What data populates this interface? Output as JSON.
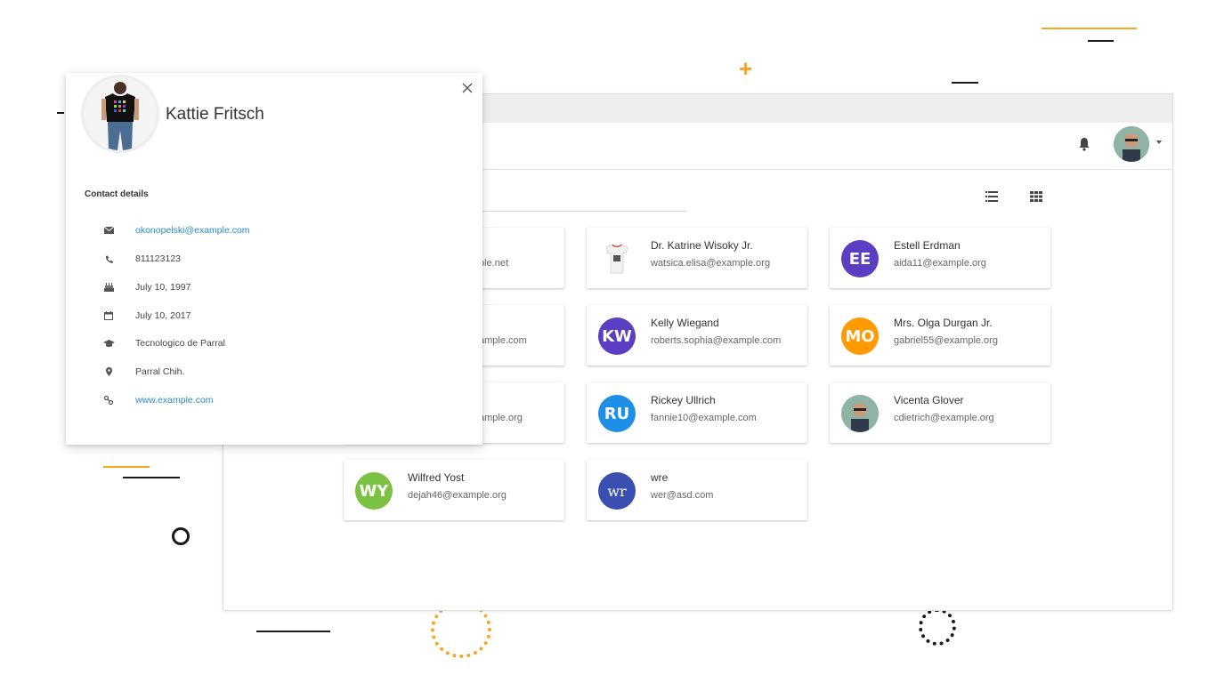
{
  "profile": {
    "name": "Kattie Fritsch",
    "section_title": "Contact details",
    "email": "okonopelski@example.com",
    "phone": "811123123",
    "birthday": "July 10, 1997",
    "date": "July 10, 2017",
    "school": "Tecnologico de Parral",
    "location": "Parral Chih.",
    "website": "www.example.com"
  },
  "contacts": [
    {
      "name": "",
      "email": "ple.net",
      "initials": "",
      "color": "#ffffff"
    },
    {
      "name": "Dr. Katrine Wisoky Jr.",
      "email": "watsica.elisa@example.org",
      "initials": "",
      "color": "#ffffff"
    },
    {
      "name": "Estell Erdman",
      "email": "aida11@example.org",
      "initials": "EE",
      "color": "#5b3ec2"
    },
    {
      "name": "",
      "email": "ample.com",
      "initials": "",
      "color": "#ffffff"
    },
    {
      "name": "Kelly Wiegand",
      "email": "roberts.sophia@example.com",
      "initials": "KW",
      "color": "#5b3ec2"
    },
    {
      "name": "Mrs. Olga Durgan Jr.",
      "email": "gabriel55@example.org",
      "initials": "MO",
      "color": "#ff9a00"
    },
    {
      "name": "",
      "email": "ample.org",
      "initials": "",
      "color": "#ffffff"
    },
    {
      "name": "Rickey Ullrich",
      "email": "fannie10@example.com",
      "initials": "RU",
      "color": "#1e8fe6"
    },
    {
      "name": "Vicenta Glover",
      "email": "cdietrich@example.org",
      "initials": "",
      "color": "#9aa8a0"
    },
    {
      "name": "Wilfred Yost",
      "email": "dejah46@example.org",
      "initials": "WY",
      "color": "#7cc242"
    },
    {
      "name": "wre",
      "email": "wer@asd.com",
      "initials": "wr",
      "color": "#3a4fb0"
    }
  ],
  "icons": {
    "email": "envelope-icon",
    "phone": "phone-icon",
    "birthday": "cake-icon",
    "date": "calendar-icon",
    "school": "graduation-cap-icon",
    "location": "map-marker-icon",
    "website": "link-icon"
  },
  "colors": {
    "accent": "#f5a623",
    "link": "#2a8ac4"
  }
}
